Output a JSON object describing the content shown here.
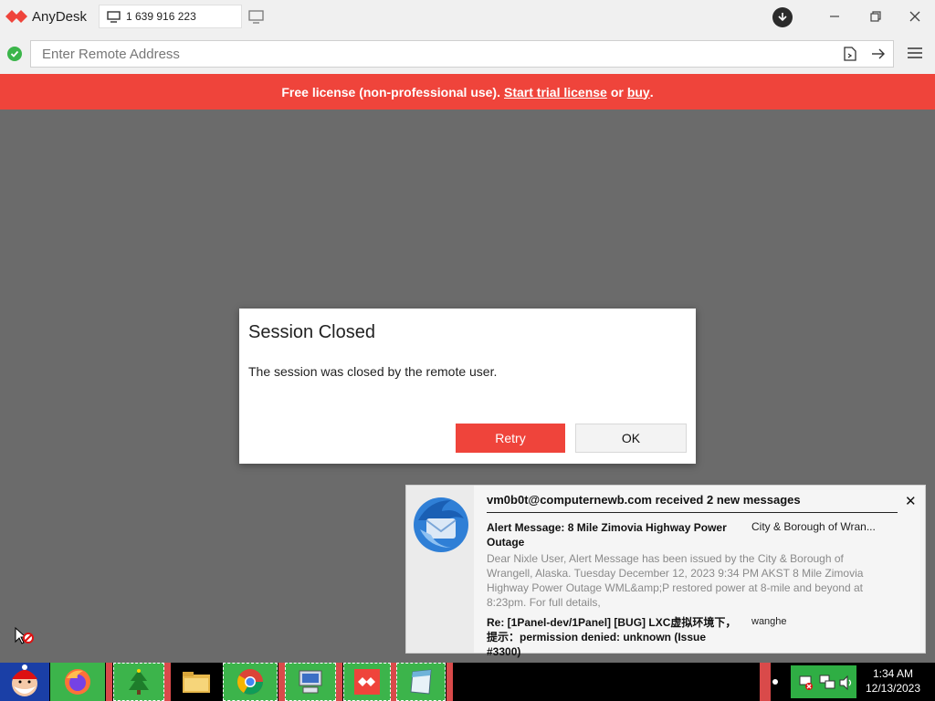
{
  "app": {
    "title": "AnyDesk",
    "tab_address": "1 639 916 223"
  },
  "address_bar": {
    "placeholder": "Enter Remote Address"
  },
  "banner": {
    "prefix": "Free license (non-professional use).",
    "trial_link": "Start trial license",
    "or": "or",
    "buy_link": "buy",
    "suffix": "."
  },
  "dialog": {
    "title": "Session Closed",
    "message": "The session was closed by the remote user.",
    "retry_label": "Retry",
    "ok_label": "OK"
  },
  "notification": {
    "header": "vm0b0t@computernewb.com received 2 new messages",
    "close": "✕",
    "messages": [
      {
        "subject": "Alert Message: 8 Mile Zimovia Highway Power Outage",
        "from": "City & Borough of Wran...",
        "preview": "Dear Nixle User, Alert Message has been issued by the City & Borough of Wrangell, Alaska. Tuesday December 12, 2023 9:34 PM AKST 8 Mile Zimovia Highway Power Outage WML&amp;P restored power at 8-mile and beyond at 8:23pm. For full details,"
      },
      {
        "subject": "Re: [1Panel-dev/1Panel] [BUG] LXC虚拟环境下，提示：permission denied: unknown (Issue #3300)",
        "from": "wanghe"
      }
    ]
  },
  "taskbar": {
    "time": "1:34 AM",
    "date": "12/13/2023"
  },
  "colors": {
    "brand_red": "#ef443b",
    "background": "#6b6b6b",
    "ok_green": "#3bb54a"
  }
}
